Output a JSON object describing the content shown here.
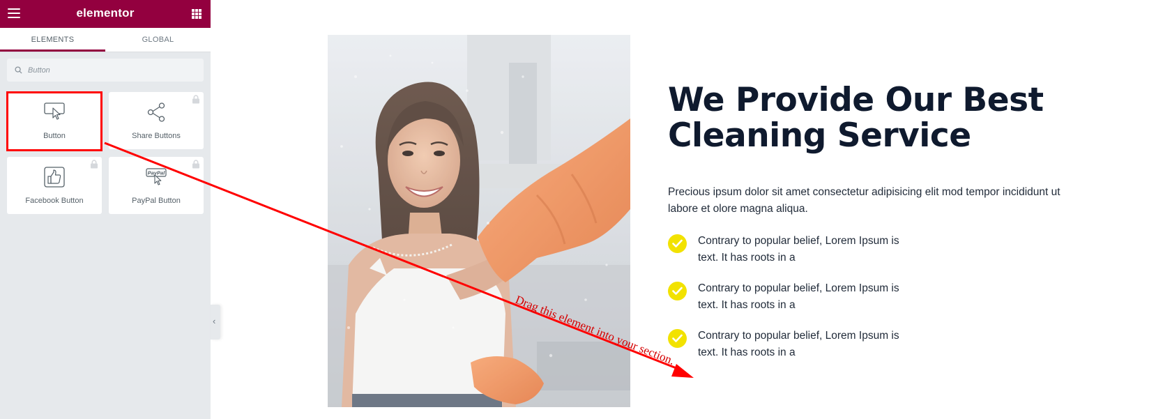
{
  "sidebar": {
    "brand": "elementor",
    "tabs": [
      {
        "label": "ELEMENTS"
      },
      {
        "label": "GLOBAL"
      }
    ],
    "search": {
      "placeholder": "Button"
    },
    "widgets": [
      {
        "label": "Button",
        "icon": "cursor-button-icon",
        "locked": false
      },
      {
        "label": "Share Buttons",
        "icon": "share-icon",
        "locked": true
      },
      {
        "label": "Facebook Button",
        "icon": "thumbs-up-icon",
        "locked": true
      },
      {
        "label": "PayPal Button",
        "icon": "paypal-icon",
        "locked": true,
        "icon_text": "PayPal"
      }
    ],
    "accent_color": "#93003f"
  },
  "annotation": {
    "text": "Drag this element into your section.",
    "color": "#ff0000"
  },
  "content": {
    "headline_line1": "We Provide Our Best",
    "headline_line2": "Cleaning Service",
    "paragraph": "Precious ipsum dolor sit amet consectetur adipisicing elit mod tempor incididunt ut labore et olore magna aliqua.",
    "bullets": [
      {
        "line1": "Contrary to popular belief, Lorem Ipsum is",
        "line2": "text. It has roots in a"
      },
      {
        "line1": "Contrary to popular belief, Lorem Ipsum is",
        "line2": "text. It has roots in a"
      },
      {
        "line1": "Contrary to popular belief, Lorem Ipsum is",
        "line2": "text. It has roots in a"
      }
    ],
    "check_color": "#f2e200",
    "heading_color": "#0f1a2e"
  }
}
